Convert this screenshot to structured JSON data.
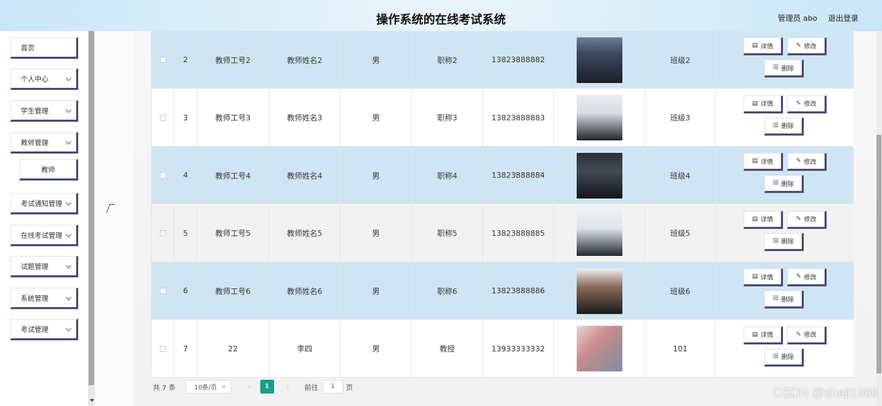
{
  "header": {
    "title": "操作系统的在线考试系统",
    "user_label": "管理员 abo",
    "logout_label": "退出登录"
  },
  "sidebar": {
    "items": [
      {
        "label": "首页"
      },
      {
        "label": "个人中心"
      },
      {
        "label": "学生管理"
      },
      {
        "label": "教师管理"
      },
      {
        "label": "教师"
      },
      {
        "label": "考试通知管理"
      },
      {
        "label": "在线考试管理"
      },
      {
        "label": "试题管理"
      },
      {
        "label": "系统管理"
      },
      {
        "label": "考试管理"
      }
    ]
  },
  "table": {
    "rows": [
      {
        "index": "2",
        "teacher_id": "教师工号2",
        "name": "教师姓名2",
        "gender": "男",
        "title": "职称2",
        "phone": "13823888882",
        "class": "班级2"
      },
      {
        "index": "3",
        "teacher_id": "教师工号3",
        "name": "教师姓名3",
        "gender": "男",
        "title": "职称3",
        "phone": "13823888883",
        "class": "班级3"
      },
      {
        "index": "4",
        "teacher_id": "教师工号4",
        "name": "教师姓名4",
        "gender": "男",
        "title": "职称4",
        "phone": "13823888884",
        "class": "班级4"
      },
      {
        "index": "5",
        "teacher_id": "教师工号5",
        "name": "教师姓名5",
        "gender": "男",
        "title": "职称5",
        "phone": "13823888885",
        "class": "班级5"
      },
      {
        "index": "6",
        "teacher_id": "教师工号6",
        "name": "教师姓名6",
        "gender": "男",
        "title": "职称6",
        "phone": "13823888886",
        "class": "班级6"
      },
      {
        "index": "7",
        "teacher_id": "22",
        "name": "李四",
        "gender": "男",
        "title": "教授",
        "phone": "13933333332",
        "class": "101"
      }
    ],
    "actions": {
      "detail_label": "详情",
      "edit_label": "修改",
      "delete_label": "删除"
    }
  },
  "pagination": {
    "total_label": "共 7 条",
    "page_size": "10条/页",
    "current_page": "1",
    "goto_label": "前往",
    "goto_value": "1",
    "page_unit": "页"
  },
  "watermark": "CSDN @sheji1999",
  "colors": {
    "header_bg": "#c9e6f6",
    "row_blue": "#cfe5f3",
    "button_shadow": "#4c4c74",
    "pager_active": "#16a085"
  }
}
